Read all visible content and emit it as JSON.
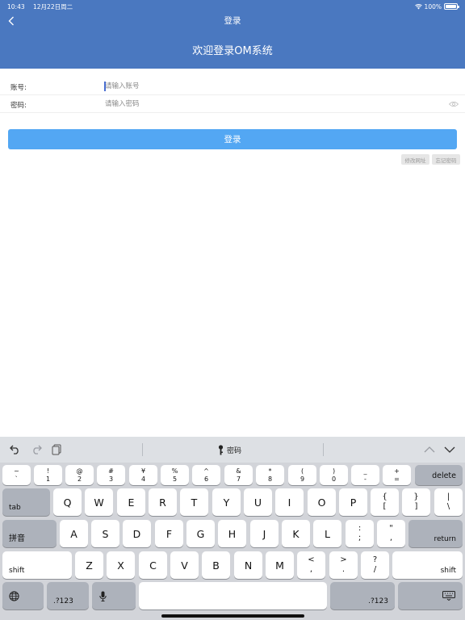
{
  "status_bar": {
    "time": "10:43",
    "date": "12月22日周二",
    "battery": "100%"
  },
  "nav": {
    "title": "登录"
  },
  "welcome": "欢迎登录OM系统",
  "form": {
    "account_label": "账号:",
    "account_placeholder": "请输入账号",
    "password_label": "密码:",
    "password_placeholder": "请输入密码"
  },
  "login_button": "登录",
  "change_url_button": "修改网址",
  "forgot_password_button": "忘记密码",
  "colors": {
    "header": "#4a78c0",
    "primary_button": "#53a7f3"
  },
  "keyboard": {
    "password_suggestion": "密码",
    "number_row": [
      {
        "top": "~",
        "bottom": "`"
      },
      {
        "top": "!",
        "bottom": "1"
      },
      {
        "top": "@",
        "bottom": "2"
      },
      {
        "top": "#",
        "bottom": "3"
      },
      {
        "top": "¥",
        "bottom": "4"
      },
      {
        "top": "%",
        "bottom": "5"
      },
      {
        "top": "^",
        "bottom": "6"
      },
      {
        "top": "&",
        "bottom": "7"
      },
      {
        "top": "*",
        "bottom": "8"
      },
      {
        "top": "(",
        "bottom": "9"
      },
      {
        "top": ")",
        "bottom": "0"
      },
      {
        "top": "_",
        "bottom": "-"
      },
      {
        "top": "+",
        "bottom": "="
      }
    ],
    "delete": "delete",
    "tab": "tab",
    "row_q": [
      "Q",
      "W",
      "E",
      "R",
      "T",
      "Y",
      "U",
      "I",
      "O",
      "P"
    ],
    "row_q_extra": [
      {
        "top": "{",
        "bottom": "["
      },
      {
        "top": "}",
        "bottom": "]"
      },
      {
        "top": "|",
        "bottom": "\\"
      }
    ],
    "pinyin": "拼音",
    "row_a": [
      "A",
      "S",
      "D",
      "F",
      "G",
      "H",
      "J",
      "K",
      "L"
    ],
    "row_a_extra": [
      {
        "top": ":",
        "bottom": ";"
      },
      {
        "top": "\"",
        "bottom": ","
      }
    ],
    "return": "return",
    "shift": "shift",
    "row_z": [
      "Z",
      "X",
      "C",
      "V",
      "B",
      "N",
      "M"
    ],
    "row_z_extra": [
      {
        "top": "<",
        "bottom": ","
      },
      {
        "top": ">",
        "bottom": "."
      },
      {
        "top": "?",
        "bottom": "/"
      }
    ],
    "numbers_key": ".?123",
    "icons": [
      "undo-icon",
      "redo-icon",
      "paste-icon",
      "key-icon",
      "chevron-up-icon",
      "chevron-down-icon",
      "globe-icon",
      "mic-icon",
      "keyboard-dismiss-icon"
    ]
  }
}
